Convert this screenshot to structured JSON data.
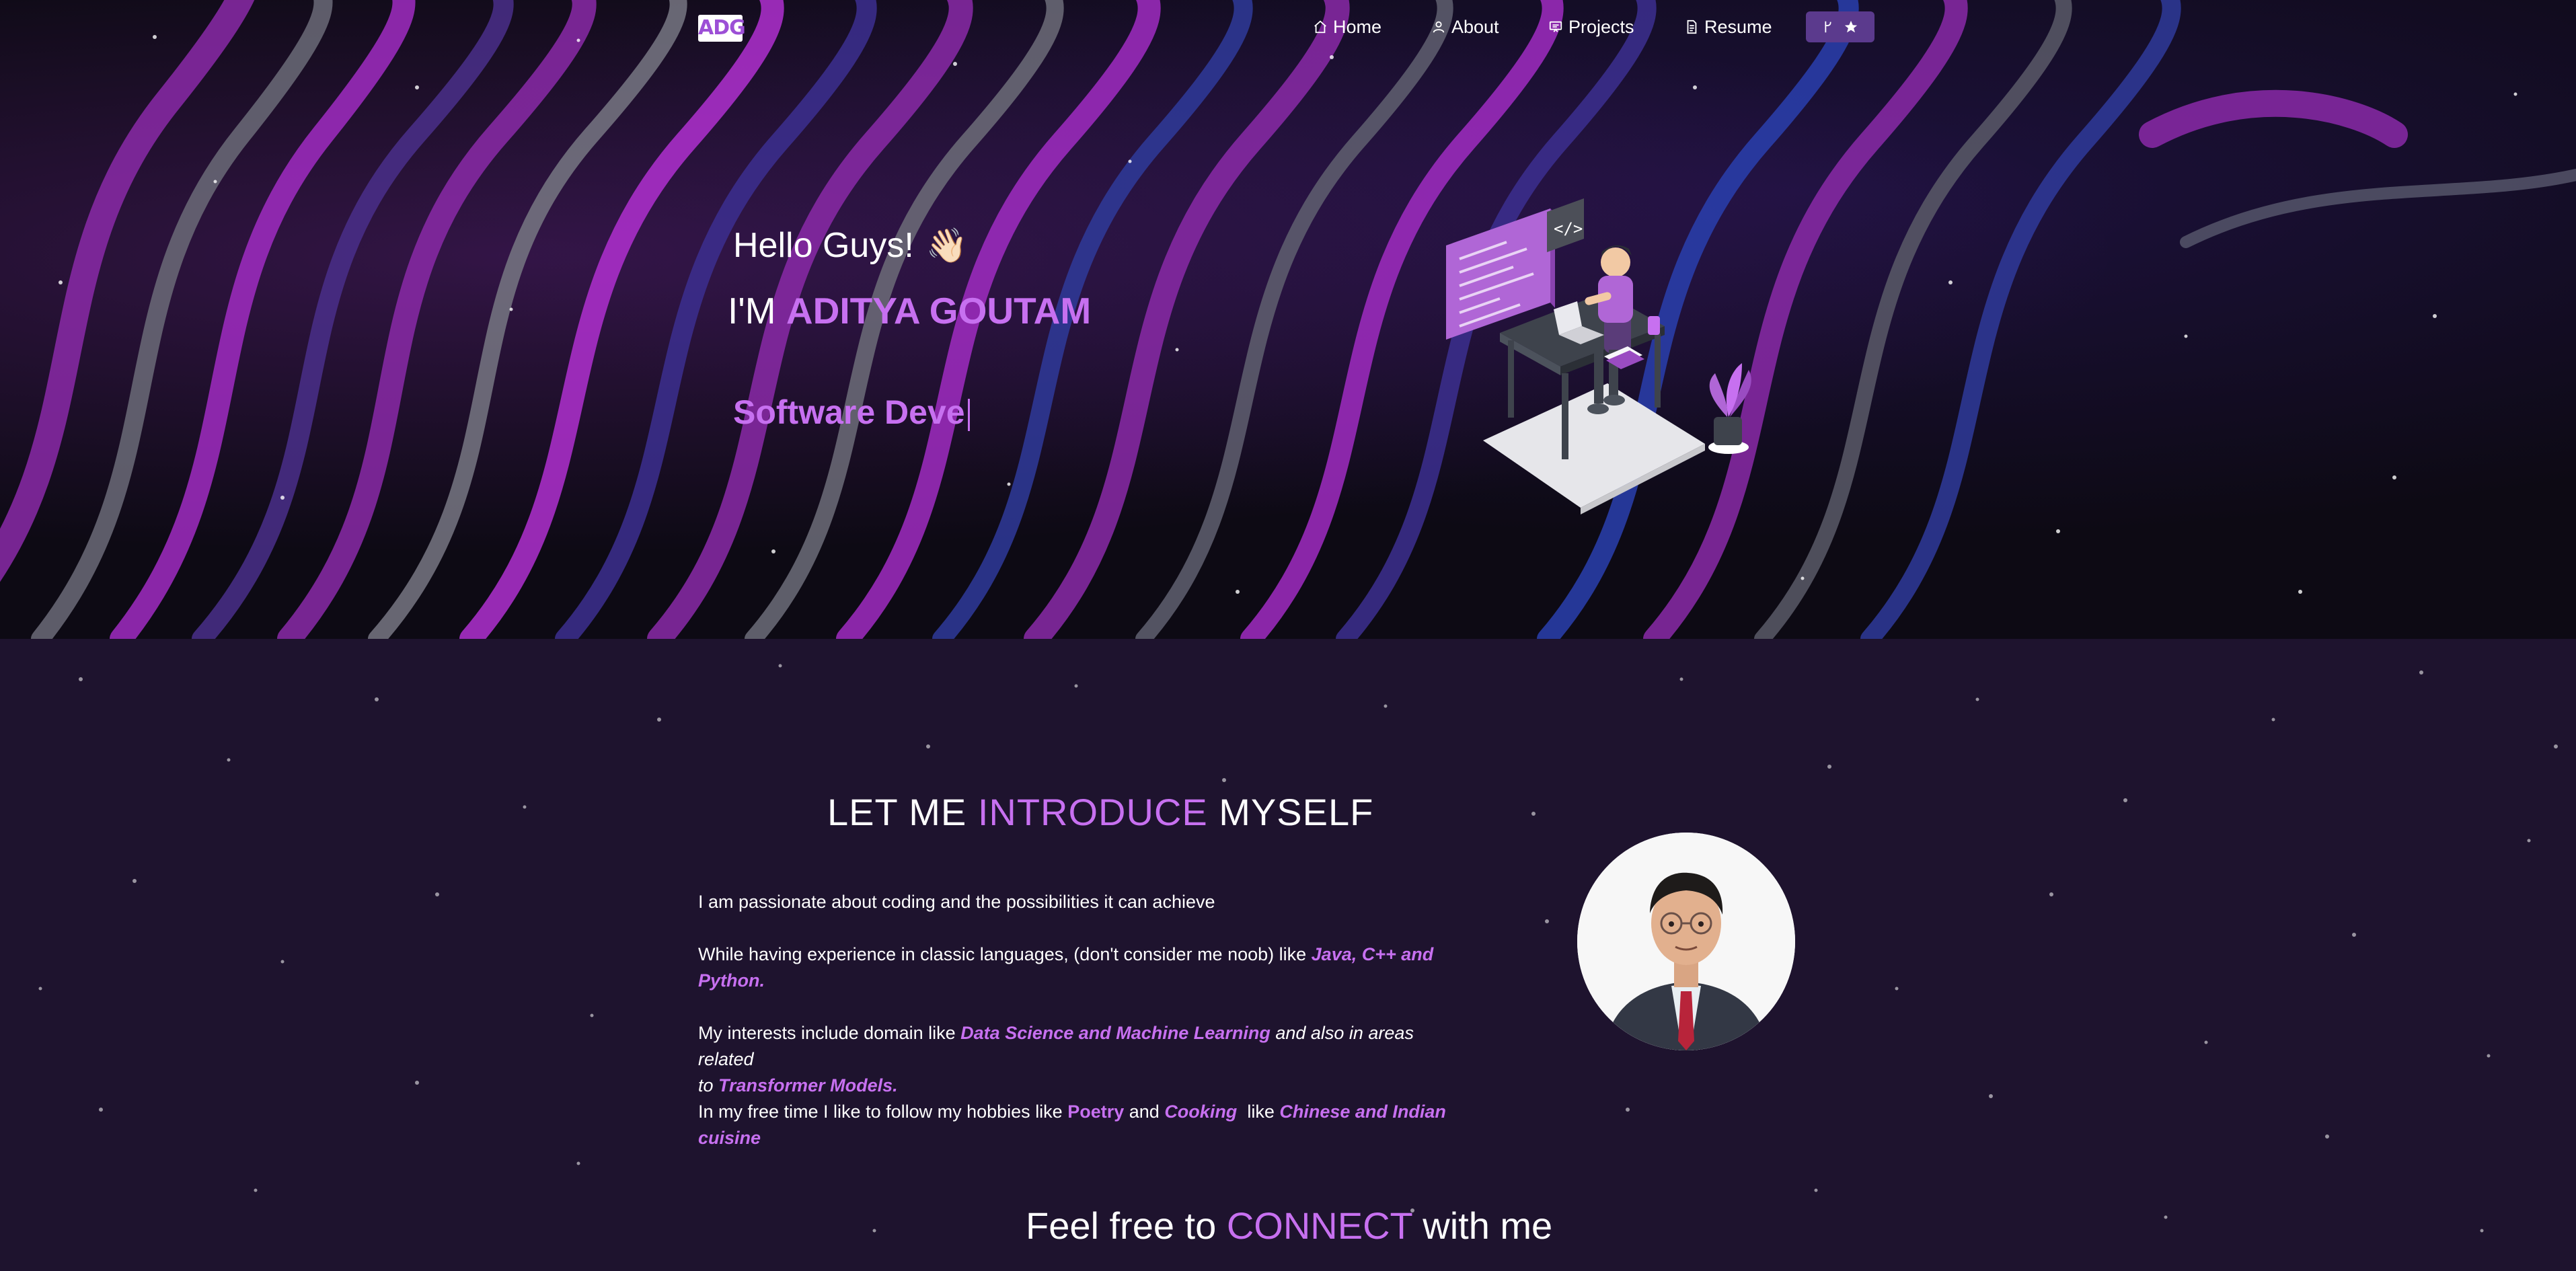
{
  "nav": {
    "logo": "ADG",
    "items": [
      {
        "label": "Home",
        "icon": "home-icon"
      },
      {
        "label": "About",
        "icon": "user-icon"
      },
      {
        "label": "Projects",
        "icon": "projects-icon"
      },
      {
        "label": "Resume",
        "icon": "document-icon"
      }
    ],
    "github_icon": "git-fork-icon",
    "star_icon": "star-icon"
  },
  "hero": {
    "greeting": "Hello Guys!",
    "wave_emoji": "👋🏻",
    "im_prefix": "I'M",
    "name": "ADITYA GOUTAM",
    "typed_text": "Software Deve",
    "illustration": "developer-at-desk-illustration"
  },
  "intro": {
    "title_part1": "LET ME",
    "title_accent": "INTRODUCE",
    "title_part2": "MYSELF",
    "p1": "I am passionate about coding and the possibilities it can achieve",
    "p2_text": "While having experience in classic languages, (don't consider me noob) like ",
    "p2_em1": "Java, C++ and",
    "p2_em2": "Python.",
    "p3_text": "My interests include domain like ",
    "p3_em": "Data Science and Machine Learning",
    "p3_rest": " and also in areas related",
    "p3_to": "to ",
    "p3_em2": "Transformer Models.",
    "p4_text": "In my free time I like to follow my hobbies like ",
    "p4_hl1": "Poetry",
    "p4_and": " and ",
    "p4_hl2": "Cooking",
    "p4_like": "  like ",
    "p4_em1": "Chinese and Indian",
    "p4_em2": "cuisine",
    "avatar": "profile-photo"
  },
  "connect": {
    "part1": "Feel free to",
    "accent": "CONNECT",
    "part2": "with me"
  },
  "colors": {
    "accent": "#c770f0",
    "bg_hero": "#0d0a14",
    "bg_lower": "#1e132e",
    "button": "#5b3a8d"
  }
}
